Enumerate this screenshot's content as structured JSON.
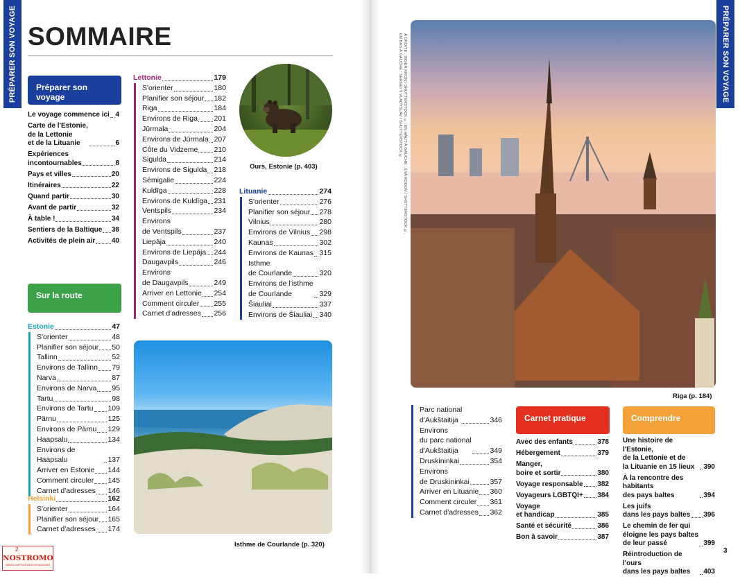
{
  "side_tab": "PRÉPARER SON VOYAGE",
  "title": "SOMMAIRE",
  "boxes": {
    "prepare": "Préparer son voyage",
    "route": "Sur la route",
    "carnet": "Carnet pratique",
    "comprendre": "Comprendre"
  },
  "prepare_items": [
    {
      "label": "Le voyage commence ici",
      "page": "4"
    },
    {
      "label": "Carte de l'Estonie,\nde la Lettonie\net de la Lituanie",
      "page": "6"
    },
    {
      "label": "Expériences\nincontournables",
      "page": "8"
    },
    {
      "label": "Pays et villes",
      "page": "20"
    },
    {
      "label": "Itinéraires",
      "page": "22"
    },
    {
      "label": "Quand partir",
      "page": "30"
    },
    {
      "label": "Avant de partir",
      "page": "32"
    },
    {
      "label": "À table !",
      "page": "34"
    },
    {
      "label": "Sentiers de la Baltique",
      "page": "38"
    },
    {
      "label": "Activités de plein air",
      "page": "40"
    }
  ],
  "estonie": {
    "head": {
      "label": "Estonie",
      "page": "47"
    },
    "color": "#1aa3b0",
    "items": [
      {
        "label": "S'orienter",
        "page": "48"
      },
      {
        "label": "Planifier son séjour",
        "page": "50"
      },
      {
        "label": "Tallinn",
        "page": "52"
      },
      {
        "label": "Environs de Tallinn",
        "page": "79"
      },
      {
        "label": "Narva",
        "page": "87"
      },
      {
        "label": "Environs de Narva",
        "page": "95"
      },
      {
        "label": "Tartu",
        "page": "98"
      },
      {
        "label": "Environs de Tartu",
        "page": "109"
      },
      {
        "label": "Pärnu",
        "page": "125"
      },
      {
        "label": "Environs de Pärnu",
        "page": "129"
      },
      {
        "label": "Haapsalu",
        "page": "134"
      },
      {
        "label": "Environs de Haapsalu",
        "page": "137"
      },
      {
        "label": "Arriver en Estonie",
        "page": "144"
      },
      {
        "label": "Comment circuler",
        "page": "145"
      },
      {
        "label": "Carnet d'adresses",
        "page": "146"
      }
    ]
  },
  "helsinki": {
    "head": {
      "label": "Helsinki",
      "page": "162"
    },
    "color": "#f3a23a",
    "items": [
      {
        "label": "S'orienter",
        "page": "164"
      },
      {
        "label": "Planifier son séjour",
        "page": "165"
      },
      {
        "label": "Carnet d'adresses",
        "page": "174"
      }
    ]
  },
  "lettonie": {
    "head": {
      "label": "Lettonie",
      "page": "179"
    },
    "color": "#a3237a",
    "items": [
      {
        "label": "S'orienter",
        "page": "180"
      },
      {
        "label": "Planifier son séjour",
        "page": "182"
      },
      {
        "label": "Riga",
        "page": "184"
      },
      {
        "label": "Environs de Riga",
        "page": "201"
      },
      {
        "label": "Jūrmala",
        "page": "204"
      },
      {
        "label": "Environs de Jūrmala",
        "page": "207"
      },
      {
        "label": "Côte du Vidzeme",
        "page": "210"
      },
      {
        "label": "Sigulda",
        "page": "214"
      },
      {
        "label": "Environs de Sigulda",
        "page": "218"
      },
      {
        "label": "Sémigalie",
        "page": "224"
      },
      {
        "label": "Kuldīga",
        "page": "228"
      },
      {
        "label": "Environs de Kuldīga",
        "page": "231"
      },
      {
        "label": "Ventspils",
        "page": "234"
      },
      {
        "label": "Environs\nde Ventspils",
        "page": "237"
      },
      {
        "label": "Liepāja",
        "page": "240"
      },
      {
        "label": "Environs de Liepāja",
        "page": "244"
      },
      {
        "label": "Daugavpils",
        "page": "246"
      },
      {
        "label": "Environs\nde Daugavpils",
        "page": "249"
      },
      {
        "label": "Arriver en Lettonie",
        "page": "254"
      },
      {
        "label": "Comment circuler",
        "page": "255"
      },
      {
        "label": "Carnet d'adresses",
        "page": "256"
      }
    ]
  },
  "lituanie": {
    "head": {
      "label": "Lituanie",
      "page": "274"
    },
    "color": "#1b3f9c",
    "items": [
      {
        "label": "S'orienter",
        "page": "276"
      },
      {
        "label": "Planifier son séjour",
        "page": "278"
      },
      {
        "label": "Vilnius",
        "page": "280"
      },
      {
        "label": "Environs de Vilnius",
        "page": "298"
      },
      {
        "label": "Kaunas",
        "page": "302"
      },
      {
        "label": "Environs de Kaunas",
        "page": "315"
      },
      {
        "label": "Isthme\nde Courlande",
        "page": "320"
      },
      {
        "label": "Environs de l'isthme\nde Courlande",
        "page": "329"
      },
      {
        "label": "Šiauliai",
        "page": "337"
      },
      {
        "label": "Environs de Šiauliai",
        "page": "340"
      }
    ],
    "items_cont": [
      {
        "label": "Parc national\nd'Aukštaitija",
        "page": "346"
      },
      {
        "label": "Environs\ndu parc national\nd'Aukštaitija",
        "page": "349"
      },
      {
        "label": "Druskininkai",
        "page": "354"
      },
      {
        "label": "Environs\nde Druskininkai",
        "page": "357"
      },
      {
        "label": "Arriver en Lituanie",
        "page": "360"
      },
      {
        "label": "Comment circuler",
        "page": "361"
      },
      {
        "label": "Carnet d'adresses",
        "page": "362"
      }
    ]
  },
  "carnet_items": [
    {
      "label": "Avec des enfants",
      "page": "378"
    },
    {
      "label": "Hébergement",
      "page": "379"
    },
    {
      "label": "Manger,\nboire et sortir",
      "page": "380"
    },
    {
      "label": "Voyage responsable",
      "page": "382"
    },
    {
      "label": "Voyageurs LGBTQI+",
      "page": "384"
    },
    {
      "label": "Voyage\net handicap",
      "page": "385"
    },
    {
      "label": "Santé et sécurité",
      "page": "386"
    },
    {
      "label": "Bon à savoir",
      "page": "387"
    }
  ],
  "comprendre_items": [
    {
      "label": "Une histoire de l'Estonie,\nde la Lettonie et de\nla Lituanie en 15 lieux",
      "page": "390"
    },
    {
      "label": "À la rencontre des habitants\ndes pays baltes",
      "page": "394"
    },
    {
      "label": "Les juifs\ndans les pays baltes",
      "page": "396"
    },
    {
      "label": "Le chemin de fer qui\néloigne les pays baltes\nde leur passé",
      "page": "399"
    },
    {
      "label": "Réintroduction de l'ours\ndans les pays baltes",
      "page": "403"
    }
  ],
  "captions": {
    "bear": "Ours, Estonie (p. 403)",
    "dune": "Isthme de Courlande (p. 320)",
    "riga": "Riga (p. 184)"
  },
  "credit": "À DROITE : INGER KRON / SHUTTERSTOCK ©, EN HAUT À GAUCHE : ILYA ROGOV / SHUTTERSTOCK ©,\nEN BAS À GAUCHE : SERGEI Y VLADYSLAV / SHUTTERSTOCK ©",
  "page_number": "3",
  "logo": {
    "top": "2",
    "name": "NOSTROMO",
    "tagline": "WEB COMPTOIR DES VOYAGEURS"
  }
}
